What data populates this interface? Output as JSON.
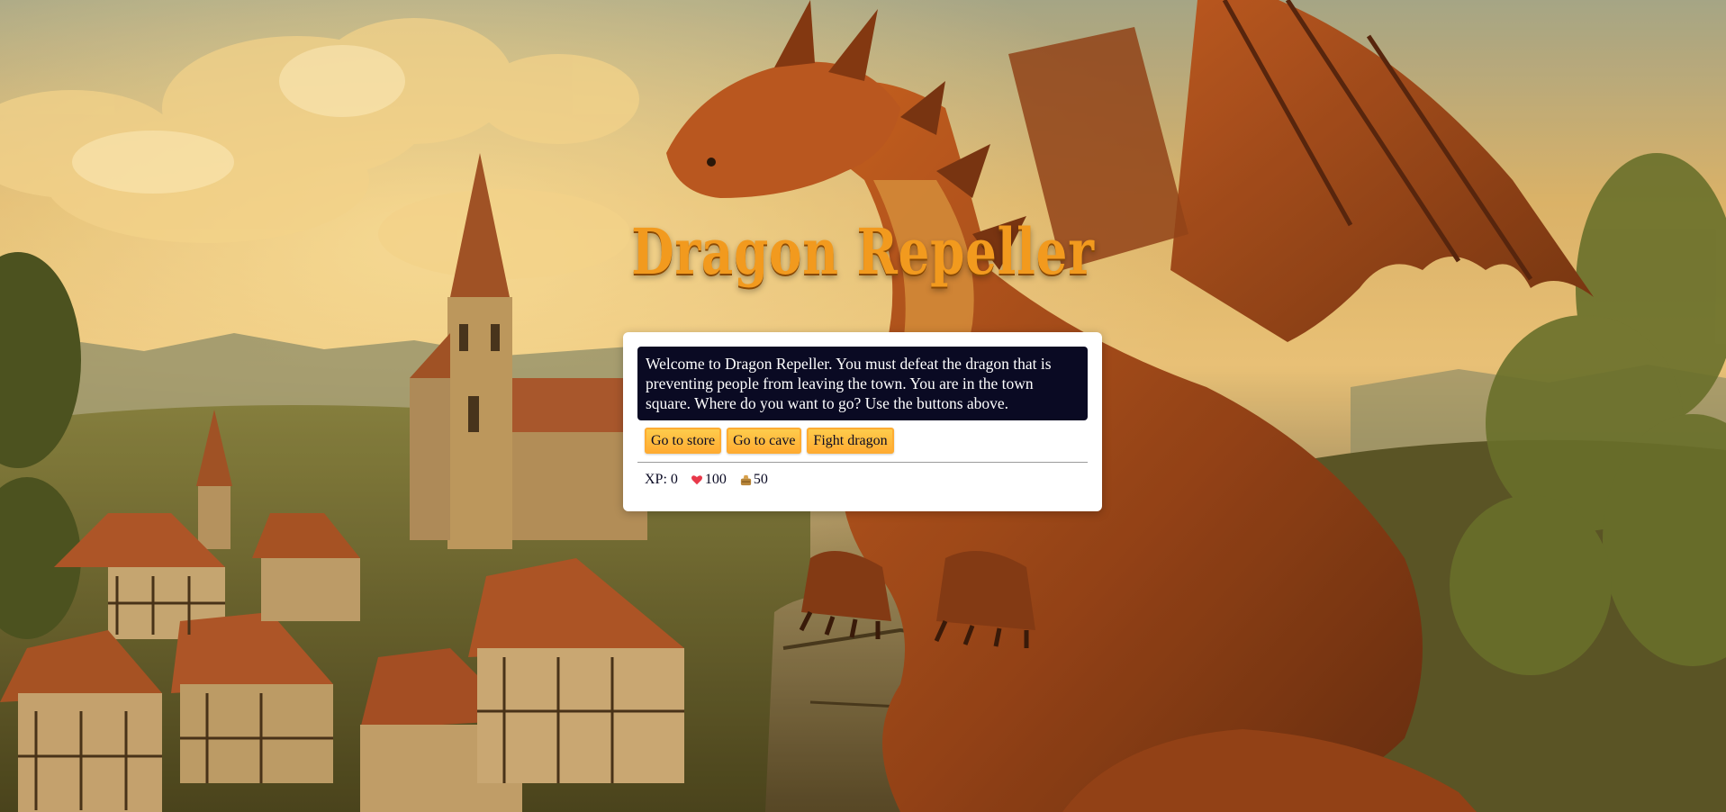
{
  "game": {
    "title": "Dragon Repeller",
    "message": "Welcome to Dragon Repeller. You must defeat the dragon that is preventing people from leaving the town. You are in the town square. Where do you want to go? Use the buttons above."
  },
  "controls": {
    "button1": "Go to store",
    "button2": "Go to cave",
    "button3": "Fight dragon"
  },
  "stats": {
    "xp_label": "XP:",
    "xp": "0",
    "health": "100",
    "gold": "50",
    "health_icon": "heart-icon",
    "gold_icon": "gold-bag-icon"
  },
  "colors": {
    "title": "#f29a1e",
    "text_box_bg": "#0a0a23",
    "button_bg": "#feac32",
    "panel_bg": "#ffffff"
  }
}
